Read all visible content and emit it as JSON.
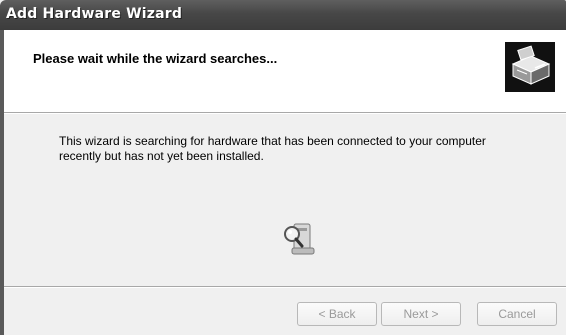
{
  "window": {
    "title": "Add Hardware Wizard"
  },
  "header": {
    "title": "Please wait while the wizard searches..."
  },
  "main": {
    "description": "This wizard is searching for hardware that has been connected to your computer recently but has not yet been installed."
  },
  "icons": {
    "header_icon": "hardware-wizard-icon",
    "status_icon": "magnifier-search-icon"
  },
  "buttons": {
    "back": "< Back",
    "next": "Next >",
    "cancel": "Cancel"
  },
  "colors": {
    "titlebar": "#474747",
    "panel": "#f0f0f0",
    "header_bg": "#ffffff",
    "disabled_text": "#9a9a9a"
  }
}
